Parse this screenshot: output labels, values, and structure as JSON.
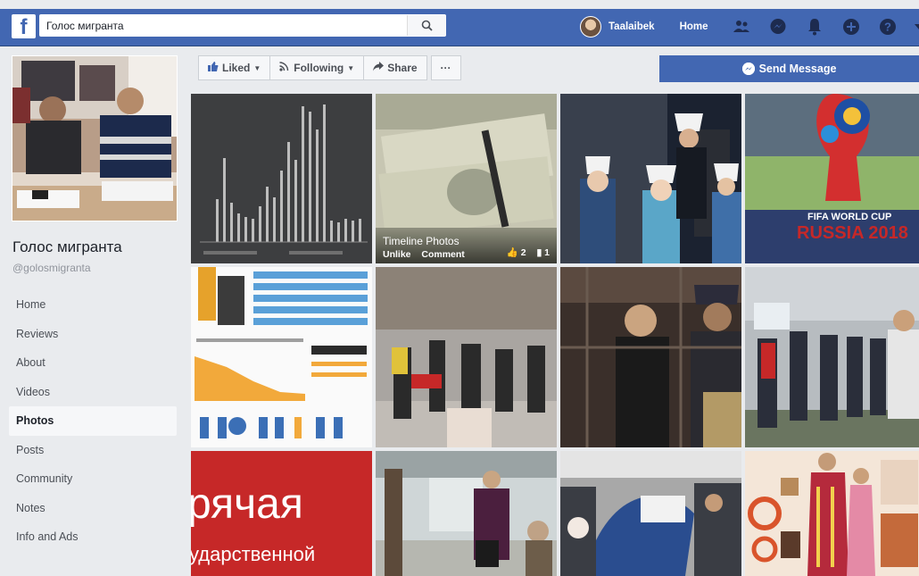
{
  "header": {
    "search_value": "Голос мигранта",
    "user_name": "Taalaibek",
    "home_label": "Home",
    "logo_letter": "f"
  },
  "page": {
    "name": "Голос мигранта",
    "handle": "@golosmigranta"
  },
  "sidebar": {
    "items": [
      {
        "label": "Home"
      },
      {
        "label": "Reviews"
      },
      {
        "label": "About"
      },
      {
        "label": "Videos"
      },
      {
        "label": "Photos",
        "active": true
      },
      {
        "label": "Posts"
      },
      {
        "label": "Community"
      },
      {
        "label": "Notes"
      },
      {
        "label": "Info and Ads"
      }
    ]
  },
  "actions": {
    "liked_label": "Liked",
    "following_label": "Following",
    "share_label": "Share",
    "more_label": "···",
    "send_message_label": "Send Message"
  },
  "photos": {
    "hover_title": "Timeline Photos",
    "hover_unlike": "Unlike",
    "hover_comment": "Comment",
    "like_count": "2",
    "comment_count": "1",
    "worldcup_line1": "FIFA WORLD CUP",
    "worldcup_line2": "RUSSIA 2018",
    "red_line1": "рячая",
    "red_line2": "ударственной"
  },
  "colors": {
    "brand": "#4267b2",
    "background": "#e9ebee"
  }
}
